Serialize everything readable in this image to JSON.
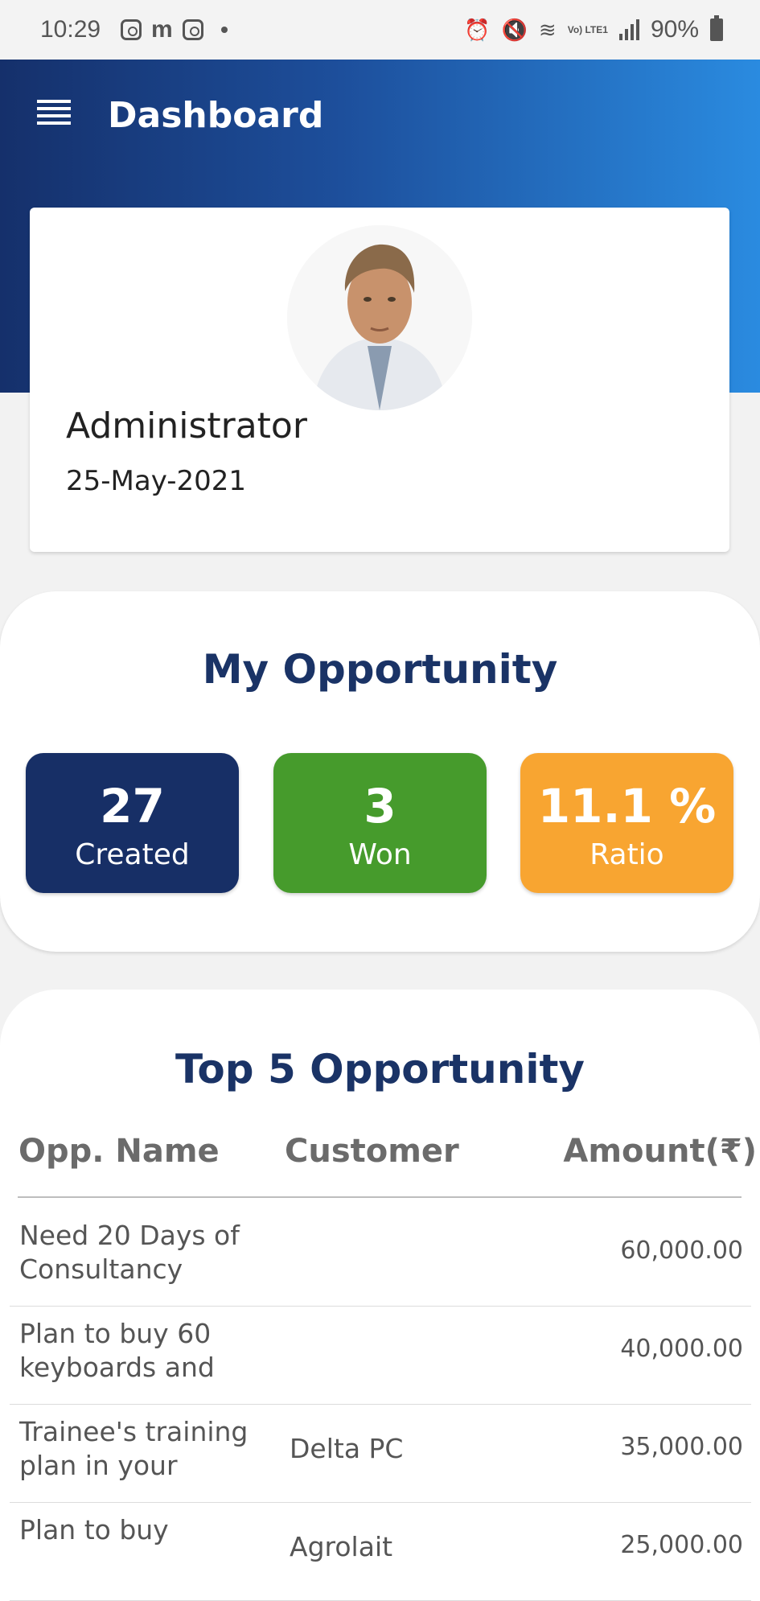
{
  "status_bar": {
    "time": "10:29",
    "battery": "90%",
    "network": "Vo) LTE1"
  },
  "header": {
    "title": "Dashboard"
  },
  "profile": {
    "name": "Administrator",
    "date": "25-May-2021"
  },
  "my_opportunity": {
    "title": "My Opportunity",
    "tiles": [
      {
        "value": "27",
        "label": "Created",
        "color": "#172f66"
      },
      {
        "value": "3",
        "label": "Won",
        "color": "#469b2c"
      },
      {
        "value": "11.1 %",
        "label": "Ratio",
        "color": "#f8a531"
      }
    ]
  },
  "top_opportunity": {
    "title": "Top 5 Opportunity",
    "columns": [
      "Opp. Name",
      "Customer",
      "Amount(₹)"
    ],
    "rows": [
      {
        "name": "Need 20 Days of Consultancy",
        "customer": "",
        "amount": "60,000.00"
      },
      {
        "name": "Plan to buy 60 keyboards and",
        "customer": "",
        "amount": "40,000.00"
      },
      {
        "name": "Trainee's training plan in your",
        "customer": "Delta PC",
        "amount": "35,000.00"
      },
      {
        "name": "Plan to buy",
        "customer": "Agrolait",
        "amount": "25,000.00"
      }
    ]
  }
}
